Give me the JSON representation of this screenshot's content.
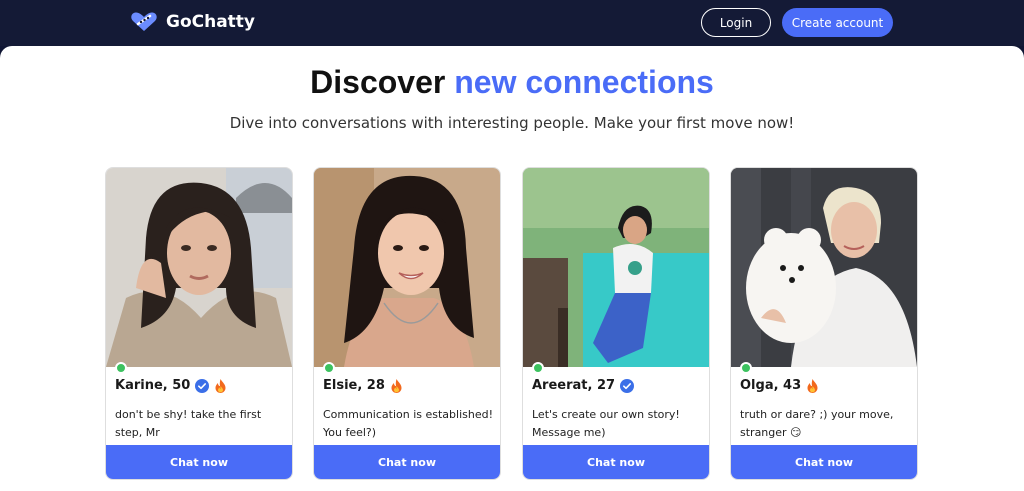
{
  "brand": {
    "name": "GoChatty",
    "accent_color": "#4a6cf7"
  },
  "nav": {
    "login_label": "Login",
    "create_account_label": "Create account"
  },
  "hero": {
    "title_prefix": "Discover",
    "title_accent": "new connections",
    "subtitle": "Dive into conversations with interesting people. Make your first move now!"
  },
  "profiles": [
    {
      "name": "Karine, 50",
      "verified": true,
      "hot": true,
      "online": true,
      "bio": "don't be shy! take the first step, Mr",
      "cta": "Chat now"
    },
    {
      "name": "Elsie, 28",
      "verified": false,
      "hot": true,
      "online": true,
      "bio": "Communication is established! You feel?)",
      "cta": "Chat now"
    },
    {
      "name": "Areerat, 27",
      "verified": true,
      "hot": false,
      "online": true,
      "bio": "Let's create our own story! Message me)",
      "cta": "Chat now"
    },
    {
      "name": "Olga, 43",
      "verified": false,
      "hot": true,
      "online": true,
      "bio": "truth or dare? ;) your move, stranger 😏",
      "cta": "Chat now"
    }
  ],
  "icons": {
    "verified": "verified-badge-icon",
    "hot": "fire-icon",
    "online": "online-status-dot"
  }
}
